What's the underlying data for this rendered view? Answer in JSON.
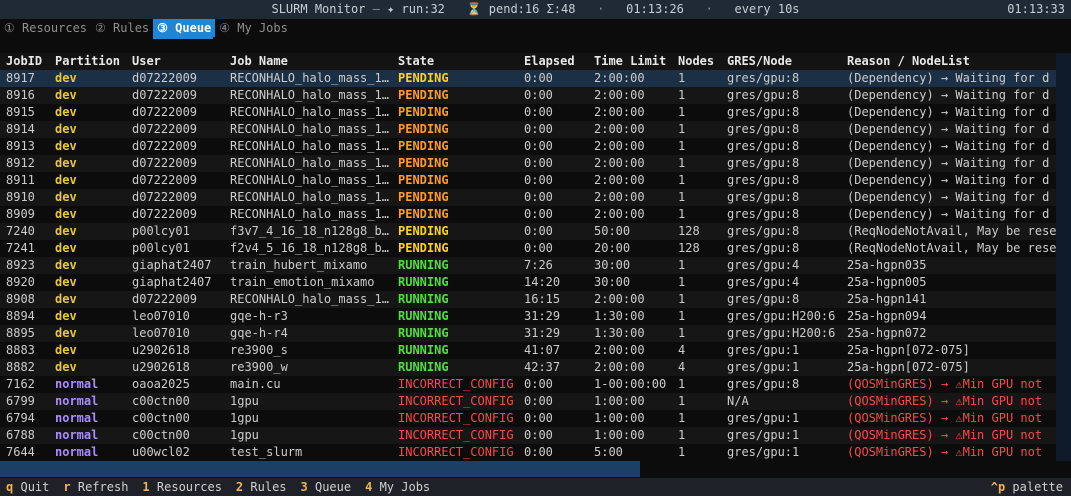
{
  "titlebar": {
    "app_title": "SLURM Monitor",
    "dash": "—",
    "run": "✦ run:32",
    "pend_icon": "⏳",
    "pend": "pend:16",
    "sigma": "Σ:48",
    "dot1": "·",
    "time": "01:13:26",
    "dot2": "·",
    "refresh": "every 10s",
    "clock": "01:13:33"
  },
  "tabs": [
    {
      "icon": "①",
      "label": "Resources"
    },
    {
      "icon": "②",
      "label": "Rules"
    },
    {
      "icon": "③",
      "label": "Queue"
    },
    {
      "icon": "④",
      "label": "My Jobs"
    }
  ],
  "table": {
    "columns": [
      "JobID",
      "Partition",
      "User",
      "Job Name",
      "State",
      "Elapsed",
      "Time Limit",
      "Nodes",
      "GRES/Node",
      "Reason / NodeList"
    ],
    "rows": [
      [
        "8917",
        "dev",
        "d07222009",
        "RECONHALO_halo_mass_1…",
        "PENDING",
        "0:00",
        "2:00:00",
        "1",
        "gres/gpu:8",
        "(Dependency)  →  Waiting for d"
      ],
      [
        "8916",
        "dev",
        "d07222009",
        "RECONHALO_halo_mass_1…",
        "PENDING",
        "0:00",
        "2:00:00",
        "1",
        "gres/gpu:8",
        "(Dependency)  →  Waiting for d"
      ],
      [
        "8915",
        "dev",
        "d07222009",
        "RECONHALO_halo_mass_1…",
        "PENDING",
        "0:00",
        "2:00:00",
        "1",
        "gres/gpu:8",
        "(Dependency)  →  Waiting for d"
      ],
      [
        "8914",
        "dev",
        "d07222009",
        "RECONHALO_halo_mass_1…",
        "PENDING",
        "0:00",
        "2:00:00",
        "1",
        "gres/gpu:8",
        "(Dependency)  →  Waiting for d"
      ],
      [
        "8913",
        "dev",
        "d07222009",
        "RECONHALO_halo_mass_1…",
        "PENDING",
        "0:00",
        "2:00:00",
        "1",
        "gres/gpu:8",
        "(Dependency)  →  Waiting for d"
      ],
      [
        "8912",
        "dev",
        "d07222009",
        "RECONHALO_halo_mass_1…",
        "PENDING",
        "0:00",
        "2:00:00",
        "1",
        "gres/gpu:8",
        "(Dependency)  →  Waiting for d"
      ],
      [
        "8911",
        "dev",
        "d07222009",
        "RECONHALO_halo_mass_1…",
        "PENDING",
        "0:00",
        "2:00:00",
        "1",
        "gres/gpu:8",
        "(Dependency)  →  Waiting for d"
      ],
      [
        "8910",
        "dev",
        "d07222009",
        "RECONHALO_halo_mass_1…",
        "PENDING",
        "0:00",
        "2:00:00",
        "1",
        "gres/gpu:8",
        "(Dependency)  →  Waiting for d"
      ],
      [
        "8909",
        "dev",
        "d07222009",
        "RECONHALO_halo_mass_1…",
        "PENDING",
        "0:00",
        "2:00:00",
        "1",
        "gres/gpu:8",
        "(Dependency)  →  Waiting for d"
      ],
      [
        "7240",
        "dev",
        "p00lcy01",
        "f3v7_4_16_18_n128g8_b…",
        "PENDING",
        "0:00",
        "50:00",
        "128",
        "gres/gpu:8",
        "(ReqNodeNotAvail, May be reser"
      ],
      [
        "7241",
        "dev",
        "p00lcy01",
        "f2v4_5_16_18_n128g8_b…",
        "PENDING",
        "0:00",
        "20:00",
        "128",
        "gres/gpu:8",
        "(ReqNodeNotAvail, May be reser"
      ],
      [
        "8923",
        "dev",
        "giaphat2407",
        "train_hubert_mixamo",
        "RUNNING",
        "7:26",
        "30:00",
        "1",
        "gres/gpu:4",
        "25a-hgpn035"
      ],
      [
        "8920",
        "dev",
        "giaphat2407",
        "train_emotion_mixamo",
        "RUNNING",
        "14:20",
        "30:00",
        "1",
        "gres/gpu:4",
        "25a-hgpn005"
      ],
      [
        "8908",
        "dev",
        "d07222009",
        "RECONHALO_halo_mass_1…",
        "RUNNING",
        "16:15",
        "2:00:00",
        "1",
        "gres/gpu:8",
        "25a-hgpn141"
      ],
      [
        "8894",
        "dev",
        "leo07010",
        "gqe-h-r3",
        "RUNNING",
        "31:29",
        "1:30:00",
        "1",
        "gres/gpu:H200:6",
        "25a-hgpn094"
      ],
      [
        "8895",
        "dev",
        "leo07010",
        "gqe-h-r4",
        "RUNNING",
        "31:29",
        "1:30:00",
        "1",
        "gres/gpu:H200:6",
        "25a-hgpn072"
      ],
      [
        "8883",
        "dev",
        "u2902618",
        "re3900_s",
        "RUNNING",
        "41:07",
        "2:00:00",
        "4",
        "gres/gpu:1",
        "25a-hgpn[072-075]"
      ],
      [
        "8882",
        "dev",
        "u2902618",
        "re3900_w",
        "RUNNING",
        "42:37",
        "2:00:00",
        "4",
        "gres/gpu:1",
        "25a-hgpn[072-075]"
      ],
      [
        "7162",
        "normal",
        "oaoa2025",
        "main.cu",
        "INCORRECT_CONFIG",
        "0:00",
        "1-00:00:00",
        "1",
        "gres/gpu:8",
        "(QOSMinGRES)  →  ⚠Min GPU not"
      ],
      [
        "6799",
        "normal",
        "c00ctn00",
        "1gpu",
        "INCORRECT_CONFIG",
        "0:00",
        "1:00:00",
        "1",
        "N/A",
        "(QOSMinGRES)  →  ⚠Min GPU not"
      ],
      [
        "6794",
        "normal",
        "c00ctn00",
        "1gpu",
        "INCORRECT_CONFIG",
        "0:00",
        "1:00:00",
        "1",
        "gres/gpu:1",
        "(QOSMinGRES)  →  ⚠Min GPU not"
      ],
      [
        "6788",
        "normal",
        "c00ctn00",
        "1gpu",
        "INCORRECT_CONFIG",
        "0:00",
        "1:00:00",
        "1",
        "gres/gpu:1",
        "(QOSMinGRES)  →  ⚠Min GPU not"
      ],
      [
        "7644",
        "normal",
        "u00wcl02",
        "test_slurm",
        "INCORRECT_CONFIG",
        "0:00",
        "5:00",
        "1",
        "gres/gpu:1",
        "(QOSMinGRES)  →  ⚠Min GPU not"
      ]
    ]
  },
  "footer": {
    "items": [
      {
        "key": "q",
        "label": "Quit"
      },
      {
        "key": "r",
        "label": "Refresh"
      },
      {
        "key": "1",
        "label": "Resources"
      },
      {
        "key": "2",
        "label": "Rules"
      },
      {
        "key": "3",
        "label": "Queue"
      },
      {
        "key": "4",
        "label": "My Jobs"
      }
    ],
    "palette_key": "^p",
    "palette_label": "palette"
  },
  "colors": {
    "accent": "#1c86d9",
    "pending": "#ffd21f",
    "pending_alt": "#ff9b26",
    "running": "#4ee03b",
    "incorrect": "#ff4747",
    "partition_dev": "#e8c93b",
    "partition_normal": "#a98cff"
  }
}
